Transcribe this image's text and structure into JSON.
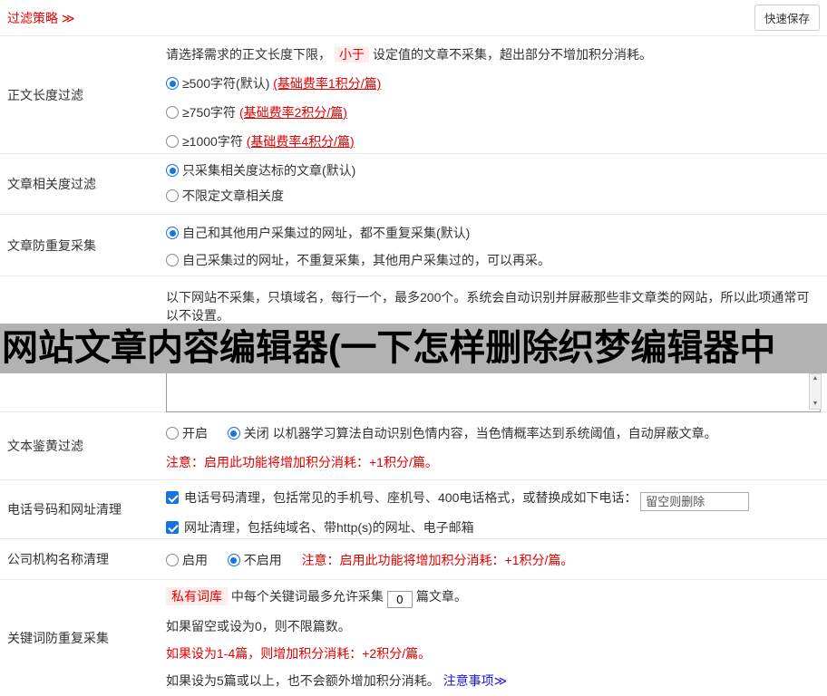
{
  "header": {
    "title": "过滤策略 ≫",
    "save_button": "快速保存"
  },
  "colors": {
    "accent_red": "#e60000",
    "link_blue": "#1a1ae0",
    "checkbox_blue": "#1673e6",
    "overlay_gray": "#b2b2b2"
  },
  "body_length": {
    "label": "正文长度过滤",
    "intro_before": "请选择需求的正文长度下限，",
    "highlight": "小于",
    "intro_after": "设定值的文章不采集，超出部分不增加积分消耗。",
    "options": [
      {
        "text": "≥500字符(默认)",
        "note": "(基础费率1积分/篇)",
        "selected": true
      },
      {
        "text": "≥750字符",
        "note": "(基础费率2积分/篇)",
        "selected": false
      },
      {
        "text": "≥1000字符",
        "note": "(基础费率4积分/篇)",
        "selected": false
      }
    ]
  },
  "relevance": {
    "label": "文章相关度过滤",
    "options": [
      {
        "text": "只采集相关度达标的文章(默认)",
        "selected": true
      },
      {
        "text": "不限定文章相关度",
        "selected": false
      }
    ]
  },
  "dedup": {
    "label": "文章防重复采集",
    "options": [
      {
        "text": "自己和其他用户采集过的网址，都不重复采集(默认)",
        "selected": true
      },
      {
        "text": "自己采集过的网址，不重复采集，其他用户采集过的，可以再采。",
        "selected": false
      }
    ]
  },
  "blacklist": {
    "intro": "以下网站不采集，只填域名，每行一个，最多200个。系统会自动识别并屏蔽那些非文章类的网站，所以此项通常可以不设置。",
    "overlay_text": "网站文章内容编辑器(一下怎样删除织梦编辑器中",
    "textarea_value": ""
  },
  "porn_filter": {
    "label": "文本鉴黄过滤",
    "option_on": "开启",
    "option_off": "关闭",
    "description": "以机器学习算法自动识别色情内容，当色情概率达到系统阈值，自动屏蔽文章。",
    "note": "注意：启用此功能将增加积分消耗：+1积分/篇。"
  },
  "phone_url_clean": {
    "label": "电话号码和网址清理",
    "phone_text": "电话号码清理，包括常见的手机号、座机号、400电话格式，或替换成如下电话：",
    "phone_placeholder": "留空则删除",
    "url_text": "网址清理，包括纯域名、带http(s)的网址、电子邮箱"
  },
  "company_clean": {
    "label": "公司机构名称清理",
    "option_on": "启用",
    "option_off": "不启用",
    "note": "注意：启用此功能将增加积分消耗：+1积分/篇。"
  },
  "keyword_dedup": {
    "label": "关键词防重复采集",
    "lexicon_link": "私有词库",
    "line1_mid": "中每个关键词最多允许采集",
    "count_value": "0",
    "line1_end": "篇文章。",
    "line2": "如果留空或设为0，则不限篇数。",
    "line3": "如果设为1-4篇，则增加积分消耗：+2积分/篇。",
    "line4": "如果设为5篇或以上，也不会额外增加积分消耗。",
    "notice_link": "注意事项≫"
  }
}
